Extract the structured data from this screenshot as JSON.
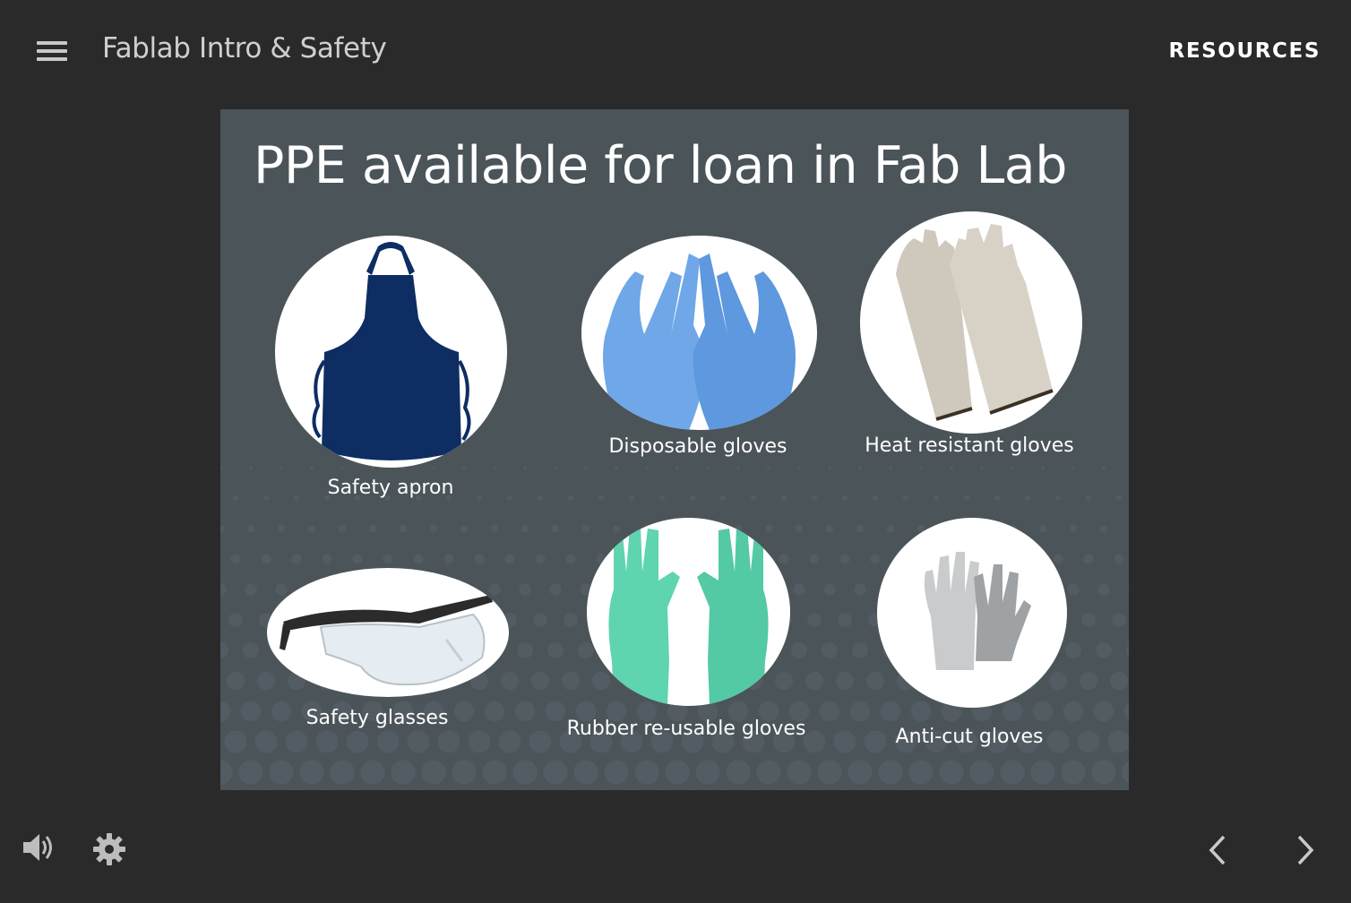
{
  "header": {
    "course_title": "Fablab Intro & Safety",
    "resources_label": "RESOURCES"
  },
  "slide": {
    "title": "PPE available for loan in Fab Lab",
    "items": [
      {
        "label": "Safety apron",
        "icon": "apron-image"
      },
      {
        "label": "Disposable gloves",
        "icon": "disposable-gloves-image"
      },
      {
        "label": "Heat resistant gloves",
        "icon": "heat-resistant-gloves-image"
      },
      {
        "label": "Safety glasses",
        "icon": "safety-glasses-image"
      },
      {
        "label": "Rubber re-usable gloves",
        "icon": "rubber-gloves-image"
      },
      {
        "label": "Anti-cut gloves",
        "icon": "anti-cut-gloves-image"
      }
    ]
  },
  "footer": {
    "volume_icon": "volume-icon",
    "settings_icon": "gear-icon",
    "prev_icon": "chevron-left-icon",
    "next_icon": "chevron-right-icon"
  },
  "colors": {
    "page_background": "#2a2a2a",
    "slide_background": "#4b5459",
    "apron": "#0d2d63",
    "disposable_gloves": "#6fa7e8",
    "rubber_gloves": "#5fd4b0"
  }
}
